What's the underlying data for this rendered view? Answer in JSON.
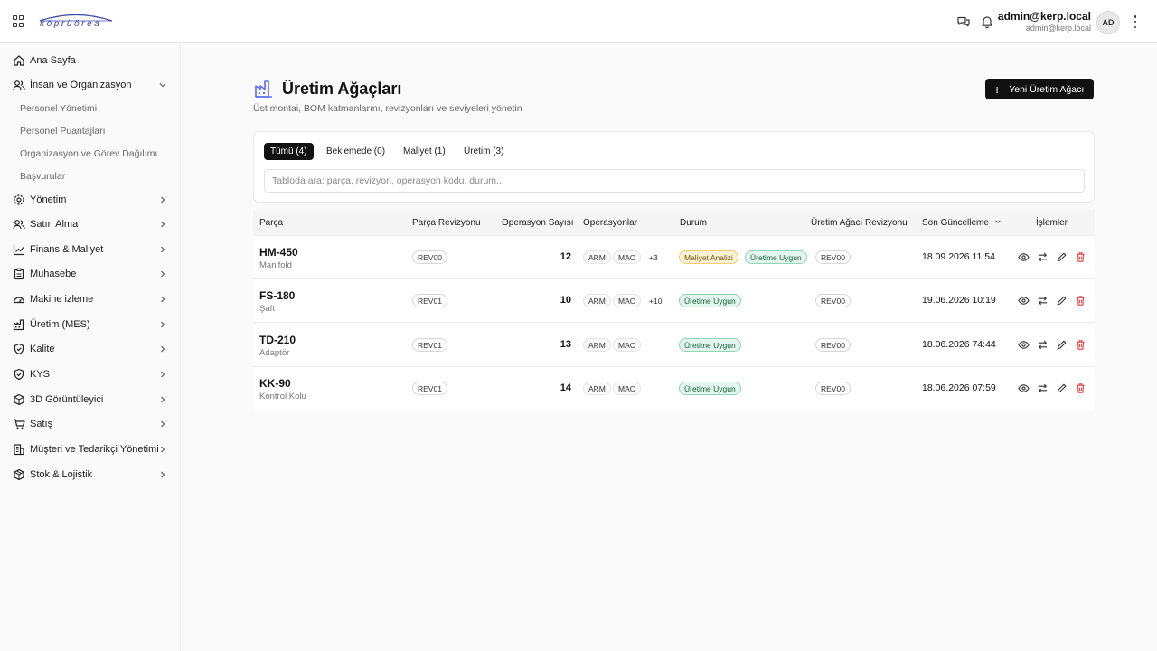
{
  "header": {
    "logo_text": "köprüörea",
    "user_name": "admin@kerp.local",
    "user_email": "admin@kerp.local",
    "avatar_initials": "AD"
  },
  "sidebar": {
    "items": [
      {
        "label": "Ana Sayfa",
        "icon": "home-icon"
      },
      {
        "label": "İnsan ve Organizasyon",
        "icon": "users-icon",
        "expanded": true,
        "children": [
          "Personel Yönetimi",
          "Personel Puantajları",
          "Organizasyon ve Görev Dağılımı",
          "Başvurular"
        ]
      },
      {
        "label": "Yönetim",
        "icon": "gear-icon"
      },
      {
        "label": "Satın Alma",
        "icon": "users-icon"
      },
      {
        "label": "Finans & Maliyet",
        "icon": "chart-line-icon"
      },
      {
        "label": "Muhasebe",
        "icon": "clipboard-icon"
      },
      {
        "label": "Makine izleme",
        "icon": "gauge-icon"
      },
      {
        "label": "Üretim (MES)",
        "icon": "factory-icon"
      },
      {
        "label": "Kalite",
        "icon": "shield-check-icon"
      },
      {
        "label": "KYS",
        "icon": "shield-check-icon"
      },
      {
        "label": "3D Görüntüleyici",
        "icon": "cube-icon"
      },
      {
        "label": "Satış",
        "icon": "cart-icon"
      },
      {
        "label": "Müşteri ve Tedarikçi Yönetimi",
        "icon": "building-icon"
      },
      {
        "label": "Stok & Lojistik",
        "icon": "package-icon"
      }
    ]
  },
  "page": {
    "title": "Üretim Ağaçları",
    "subtitle": "Üst montai, BOM katmanlarını, revizyonları ve seviyeleri yönetin",
    "new_button": "Yeni Üretim Ağacı"
  },
  "filters": {
    "tabs": [
      "Tümü (4)",
      "Beklemede (0)",
      "Maliyet (1)",
      "Üretim (3)"
    ],
    "active_tab": 0,
    "search_placeholder": "Tabloda ara: parça, revizyon, operasyon kodu, durum..."
  },
  "table": {
    "headers": [
      "Parça",
      "Parça Revizyonu",
      "Operasyon Sayısı",
      "Operasyonlar",
      "Durum",
      "Üretim Ağacı Revizyonu",
      "Son Güncelleme",
      "İşlemler"
    ],
    "rows": [
      {
        "code": "HM-450",
        "name": "Manifold",
        "part_rev": "REV00",
        "op_count": "12",
        "ops": [
          "ARM",
          "MAC"
        ],
        "ops_more": "+3",
        "statuses": [
          {
            "text": "Maliyet Analizi",
            "color": "yellow"
          },
          {
            "text": "Üretime Uygun",
            "color": "green"
          }
        ],
        "bom_rev": "REV00",
        "updated": "18.09.2026 11:54"
      },
      {
        "code": "FS-180",
        "name": "Şaft",
        "part_rev": "REV01",
        "op_count": "10",
        "ops": [
          "ARM",
          "MAC"
        ],
        "ops_more": "+10",
        "statuses": [
          {
            "text": "Üretime Uygun",
            "color": "green"
          }
        ],
        "bom_rev": "REV00",
        "updated": "19.06.2026 10:19"
      },
      {
        "code": "TD-210",
        "name": "Adaptör",
        "part_rev": "REV01",
        "op_count": "13",
        "ops": [
          "ARM",
          "MAC"
        ],
        "ops_more": "",
        "statuses": [
          {
            "text": "Üretime Uygun",
            "color": "green"
          }
        ],
        "bom_rev": "REV00",
        "updated": "18.06.2026 74:44"
      },
      {
        "code": "KK-90",
        "name": "Kontrol Kolu",
        "part_rev": "REV01",
        "op_count": "14",
        "ops": [
          "ARM",
          "MAC"
        ],
        "ops_more": "",
        "statuses": [
          {
            "text": "Üretime Uygun",
            "color": "green"
          }
        ],
        "bom_rev": "REV00",
        "updated": "18.06.2026 07:59"
      }
    ]
  },
  "colors": {
    "accent": "#111111",
    "status_green_bg": "#e3f6ee",
    "status_yellow_bg": "#fdf2d6",
    "delete_red": "#e23b3b",
    "brand_blue": "#3b4aa8"
  }
}
